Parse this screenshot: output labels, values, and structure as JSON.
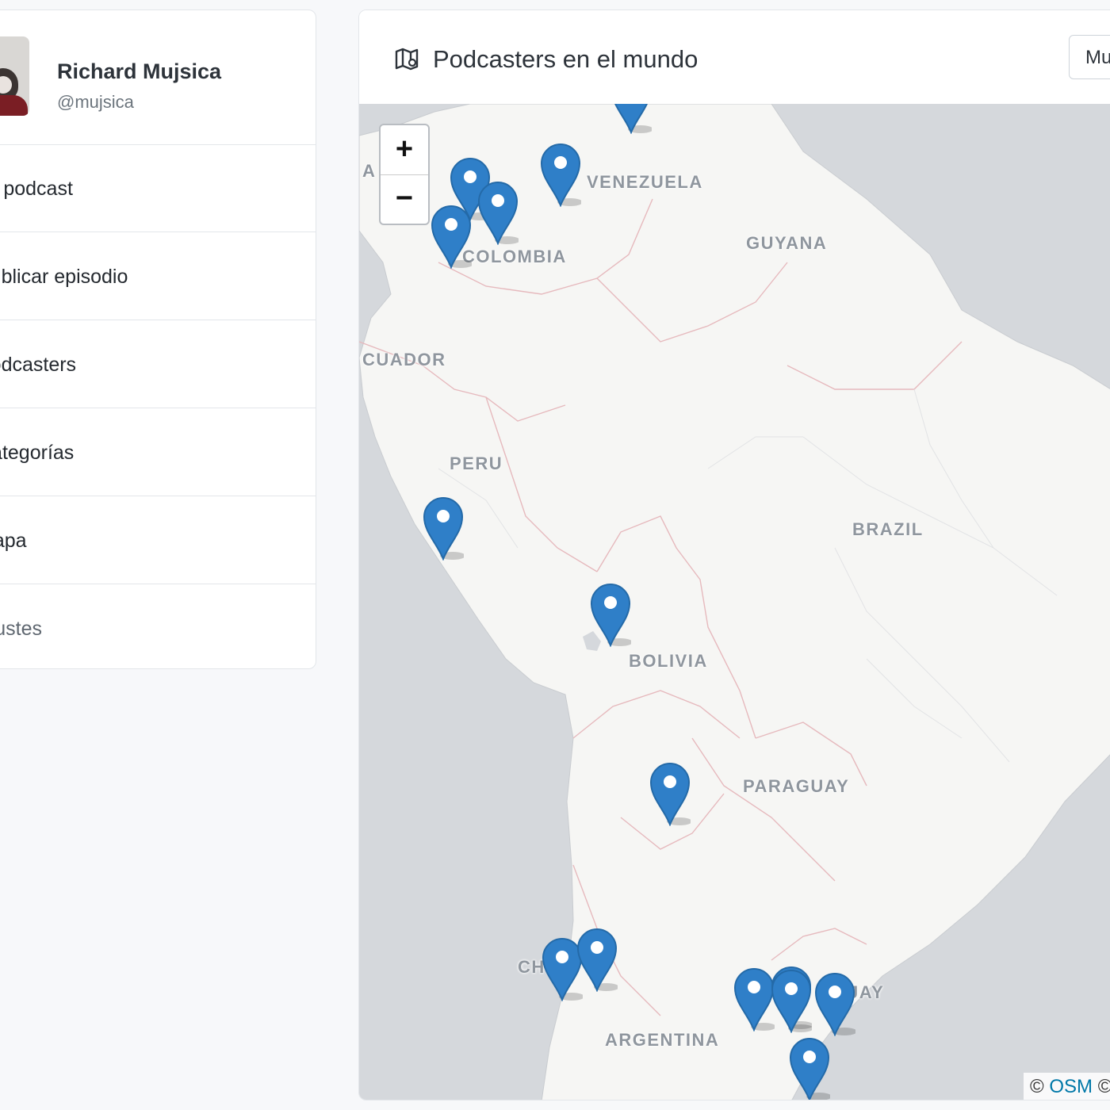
{
  "profile": {
    "name": "Richard Mujsica",
    "handle": "@mujsica"
  },
  "menu": [
    {
      "label": "Mi podcast"
    },
    {
      "label": "Publicar episodio"
    },
    {
      "label": "Podcasters"
    },
    {
      "label": "Categorías"
    },
    {
      "label": "Mapa"
    },
    {
      "label": "Ajustes"
    }
  ],
  "map_card": {
    "title": "Podcasters en el mundo",
    "icon": "map-icon",
    "scope_select": "Mu"
  },
  "map": {
    "zoom_in": "+",
    "zoom_out": "−",
    "country_labels": {
      "venezuela": "VENEZUELA",
      "colombia": "COLOMBIA",
      "guyana": "GUYANA",
      "ecuador": "CUADOR",
      "peru": "PERU",
      "brazil": "BRAZIL",
      "bolivia": "BOLIVIA",
      "paraguay": "PARAGUAY",
      "argentina": "ARGENTINA",
      "chile": "CH",
      "uruguay": "JAY",
      "edge_fragment": "A"
    },
    "attribution_prefix": "© ",
    "attribution_link": "OSM",
    "attribution_suffix": " ©",
    "marker_count": 15,
    "marker_color": "#2f7fc8",
    "land_color": "#f6f6f4",
    "water_color": "#d5d8dc"
  }
}
